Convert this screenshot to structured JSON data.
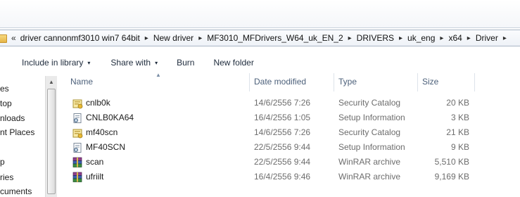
{
  "address_bar": {
    "crumbs": [
      "driver cannonmf3010 win7 64bit",
      "New driver",
      "MF3010_MFDrivers_W64_uk_EN_2",
      "DRIVERS",
      "uk_eng",
      "x64",
      "Driver"
    ],
    "leading_sep": "«",
    "sep": "▸"
  },
  "toolbar": {
    "include_in_library": "Include in library",
    "share_with": "Share with",
    "burn": "Burn",
    "new_folder": "New folder",
    "dropdown_caret": "▾"
  },
  "nav_pane": {
    "items": [
      "es",
      "top",
      "nloads",
      "nt Places",
      "p",
      "ries",
      "cuments"
    ]
  },
  "columns": {
    "name": "Name",
    "date_modified": "Date modified",
    "type": "Type",
    "size": "Size",
    "sort_indicator": "▲"
  },
  "files": [
    {
      "name": "cnlb0k",
      "date": "14/6/2556 7:26",
      "type": "Security Catalog",
      "size": "20 KB",
      "icon": "security-catalog-icon"
    },
    {
      "name": "CNLB0KA64",
      "date": "16/4/2556 1:05",
      "type": "Setup Information",
      "size": "3 KB",
      "icon": "setup-information-icon"
    },
    {
      "name": "mf40scn",
      "date": "14/6/2556 7:26",
      "type": "Security Catalog",
      "size": "21 KB",
      "icon": "security-catalog-icon"
    },
    {
      "name": "MF40SCN",
      "date": "22/5/2556 9:44",
      "type": "Setup Information",
      "size": "9 KB",
      "icon": "setup-information-icon"
    },
    {
      "name": "scan",
      "date": "22/5/2556 9:44",
      "type": "WinRAR archive",
      "size": "5,510 KB",
      "icon": "winrar-archive-icon"
    },
    {
      "name": "ufriilt",
      "date": "16/4/2556 9:46",
      "type": "WinRAR archive",
      "size": "9,169 KB",
      "icon": "winrar-archive-icon"
    }
  ]
}
